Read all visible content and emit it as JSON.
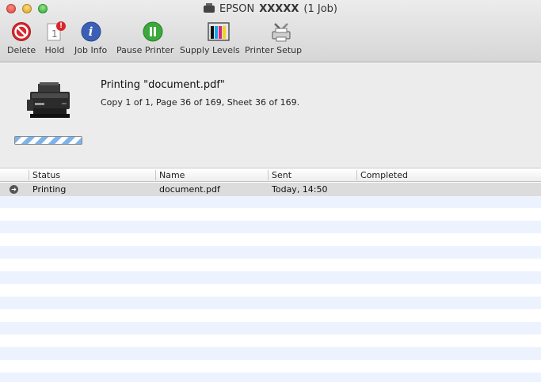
{
  "window": {
    "title_brand": "EPSON",
    "title_model": "XXXXX",
    "title_jobs": "(1 Job)"
  },
  "toolbar": {
    "delete": "Delete",
    "hold": "Hold",
    "job_info": "Job Info",
    "pause_printer": "Pause Printer",
    "supply_levels": "Supply Levels",
    "printer_setup": "Printer Setup",
    "hold_badge": "!",
    "hold_page": "1",
    "job_info_glyph": "i"
  },
  "status": {
    "title": "Printing \"document.pdf\"",
    "detail": "Copy 1 of 1, Page 36 of 169, Sheet 36 of 169."
  },
  "table": {
    "headers": {
      "status": "Status",
      "name": "Name",
      "sent": "Sent",
      "completed": "Completed"
    },
    "rows": [
      {
        "status": "Printing",
        "name": "document.pdf",
        "sent": "Today, 14:50",
        "completed": ""
      }
    ]
  },
  "colors": {
    "delete_red": "#d9262c",
    "info_blue": "#3a5fb5",
    "pause_green": "#3aa83a",
    "progress_blue": "#7eb3e8"
  }
}
